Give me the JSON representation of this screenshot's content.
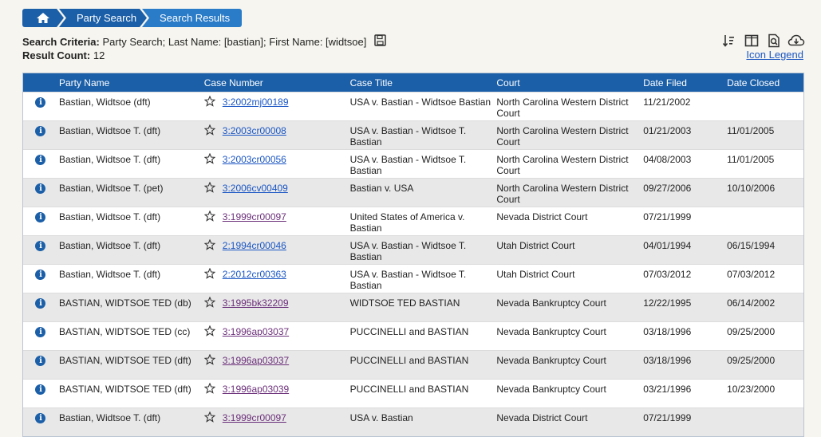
{
  "breadcrumb": {
    "items": [
      "Party Search",
      "Search Results"
    ]
  },
  "criteria": {
    "label": "Search Criteria:",
    "text": "Party Search; Last Name: [bastian]; First Name: [widtsoe]",
    "count_label": "Result Count:",
    "count": "12"
  },
  "toolbar": {
    "legend_label": "Icon Legend"
  },
  "table": {
    "headers": [
      "Party Name",
      "Case Number",
      "Case Title",
      "Court",
      "Date Filed",
      "Date Closed"
    ],
    "rows": [
      {
        "party": "Bastian, Widtsoe (dft)",
        "case": "3:2002mj00189",
        "title": "USA v. Bastian - Widtsoe Bastian",
        "court": "North Carolina Western District Court",
        "filed": "11/21/2002",
        "closed": "",
        "visited": false
      },
      {
        "party": "Bastian, Widtsoe T. (dft)",
        "case": "3:2003cr00008",
        "title": "USA v. Bastian - Widtsoe T. Bastian",
        "court": "North Carolina Western District Court",
        "filed": "01/21/2003",
        "closed": "11/01/2005",
        "visited": false
      },
      {
        "party": "Bastian, Widtsoe T. (dft)",
        "case": "3:2003cr00056",
        "title": "USA v. Bastian - Widtsoe T. Bastian",
        "court": "North Carolina Western District Court",
        "filed": "04/08/2003",
        "closed": "11/01/2005",
        "visited": false
      },
      {
        "party": "Bastian, Widtsoe T. (pet)",
        "case": "3:2006cv00409",
        "title": "Bastian v. USA",
        "court": "North Carolina Western District Court",
        "filed": "09/27/2006",
        "closed": "10/10/2006",
        "visited": false
      },
      {
        "party": "Bastian, Widtsoe T. (dft)",
        "case": "3:1999cr00097",
        "title": "United States of America v. Bastian",
        "court": "Nevada District Court",
        "filed": "07/21/1999",
        "closed": "",
        "visited": true
      },
      {
        "party": "Bastian, Widtsoe T. (dft)",
        "case": "2:1994cr00046",
        "title": "USA v. Bastian - Widtsoe T. Bastian",
        "court": "Utah District Court",
        "filed": "04/01/1994",
        "closed": "06/15/1994",
        "visited": false
      },
      {
        "party": "Bastian, Widtsoe T. (dft)",
        "case": "2:2012cr00363",
        "title": "USA v. Bastian - Widtsoe T. Bastian",
        "court": "Utah District Court",
        "filed": "07/03/2012",
        "closed": "07/03/2012",
        "visited": false
      },
      {
        "party": "BASTIAN, WIDTSOE TED (db)",
        "case": "3:1995bk32209",
        "title": "WIDTSOE TED BASTIAN",
        "court": "Nevada Bankruptcy Court",
        "filed": "12/22/1995",
        "closed": "06/14/2002",
        "visited": true
      },
      {
        "party": "BASTIAN, WIDTSOE TED (cc)",
        "case": "3:1996ap03037",
        "title": "PUCCINELLI and BASTIAN",
        "court": "Nevada Bankruptcy Court",
        "filed": "03/18/1996",
        "closed": "09/25/2000",
        "visited": true
      },
      {
        "party": "BASTIAN, WIDTSOE TED (dft)",
        "case": "3:1996ap03037",
        "title": "PUCCINELLI and BASTIAN",
        "court": "Nevada Bankruptcy Court",
        "filed": "03/18/1996",
        "closed": "09/25/2000",
        "visited": true
      },
      {
        "party": "BASTIAN, WIDTSOE TED (dft)",
        "case": "3:1996ap03039",
        "title": "PUCCINELLI and BASTIAN",
        "court": "Nevada Bankruptcy Court",
        "filed": "03/21/1996",
        "closed": "10/23/2000",
        "visited": true
      },
      {
        "party": "Bastian, Widtsoe T. (dft)",
        "case": "3:1999cr00097",
        "title": "USA v. Bastian",
        "court": "Nevada District Court",
        "filed": "07/21/1999",
        "closed": "",
        "visited": true
      }
    ]
  },
  "colors": {
    "primary": "#1b5fa8",
    "link": "#1a56c4",
    "visited": "#6b2f7a"
  }
}
